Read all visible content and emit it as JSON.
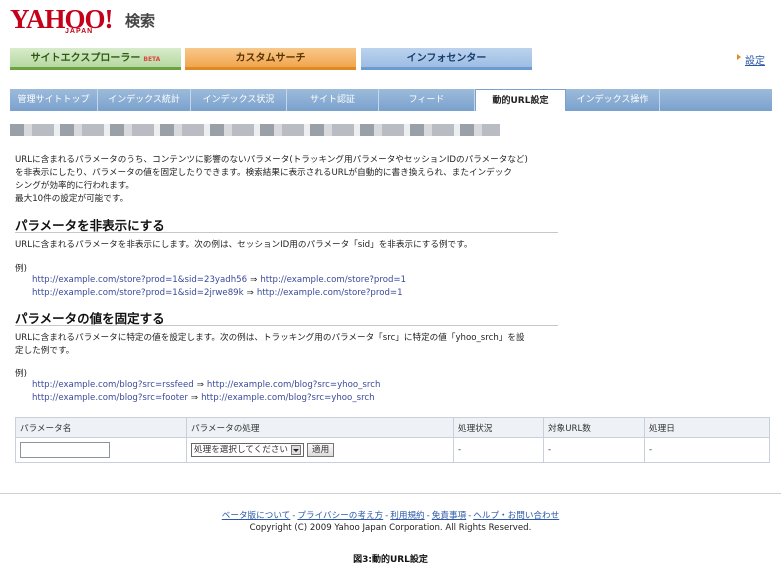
{
  "header": {
    "logo": "YAHOO!",
    "logo_sub": "JAPAN",
    "search_label": "検索",
    "settings_label": "設定"
  },
  "product_tabs": [
    {
      "label": "サイトエクスプローラー",
      "badge": "BETA"
    },
    {
      "label": "カスタムサーチ"
    },
    {
      "label": "インフォセンター"
    }
  ],
  "sub_tabs": [
    {
      "label": "管理サイトトップ"
    },
    {
      "label": "インデックス統計"
    },
    {
      "label": "インデックス状況"
    },
    {
      "label": "サイト認証"
    },
    {
      "label": "フィード"
    },
    {
      "label": "動的URL設定"
    },
    {
      "label": "インデックス操作"
    }
  ],
  "intro": {
    "p1": "URLに含まれるパラメータのうち、コンテンツに影響のないパラメータ(トラッキング用パラメータやセッションIDのパラメータなど)",
    "p2": "を非表示にしたり、パラメータの値を固定したりできます。検索結果に表示されるURLが自動的に書き換えられ、またインデック",
    "p3": "シングが効率的に行われます。",
    "p4": "最大10件の設定が可能です。"
  },
  "section_hide": {
    "title": "パラメータを非表示にする",
    "desc": "URLに含まれるパラメータを非表示にします。次の例は、セッションID用のパラメータ「sid」を非表示にする例です。",
    "example_label": "例)",
    "examples": [
      {
        "from": "http://example.com/store?prod=1&sid=23yadh56",
        "to": "http://example.com/store?prod=1"
      },
      {
        "from": "http://example.com/store?prod=1&sid=2jrwe89k",
        "to": "http://example.com/store?prod=1"
      }
    ]
  },
  "section_fix": {
    "title": "パラメータの値を固定する",
    "desc1": "URLに含まれるパラメータに特定の値を設定します。次の例は、トラッキング用のパラメータ「src」に特定の値「yhoo_srch」を設",
    "desc2": "定した例です。",
    "example_label": "例)",
    "examples": [
      {
        "from": "http://example.com/blog?src=rssfeed",
        "to": "http://example.com/blog?src=yhoo_srch"
      },
      {
        "from": "http://example.com/blog?src=footer",
        "to": "http://example.com/blog?src=yhoo_srch"
      }
    ]
  },
  "arrow_symbol": "⇒",
  "table": {
    "headers": [
      "パラメータ名",
      "パラメータの処理",
      "処理状況",
      "対象URL数",
      "処理日"
    ],
    "row": {
      "param_value": "",
      "select_value": "処理を選択してください",
      "apply_label": "適用",
      "status": "-",
      "url_count": "-",
      "date": "-"
    }
  },
  "footer": {
    "links": [
      "ベータ版について",
      "プライバシーの考え方",
      "利用規約",
      "免責事項",
      "ヘルプ・お問い合わせ"
    ],
    "separator": "-",
    "copyright": "Copyright (C) 2009 Yahoo Japan Corporation. All Rights Reserved."
  },
  "caption": "図3:動的URL設定"
}
